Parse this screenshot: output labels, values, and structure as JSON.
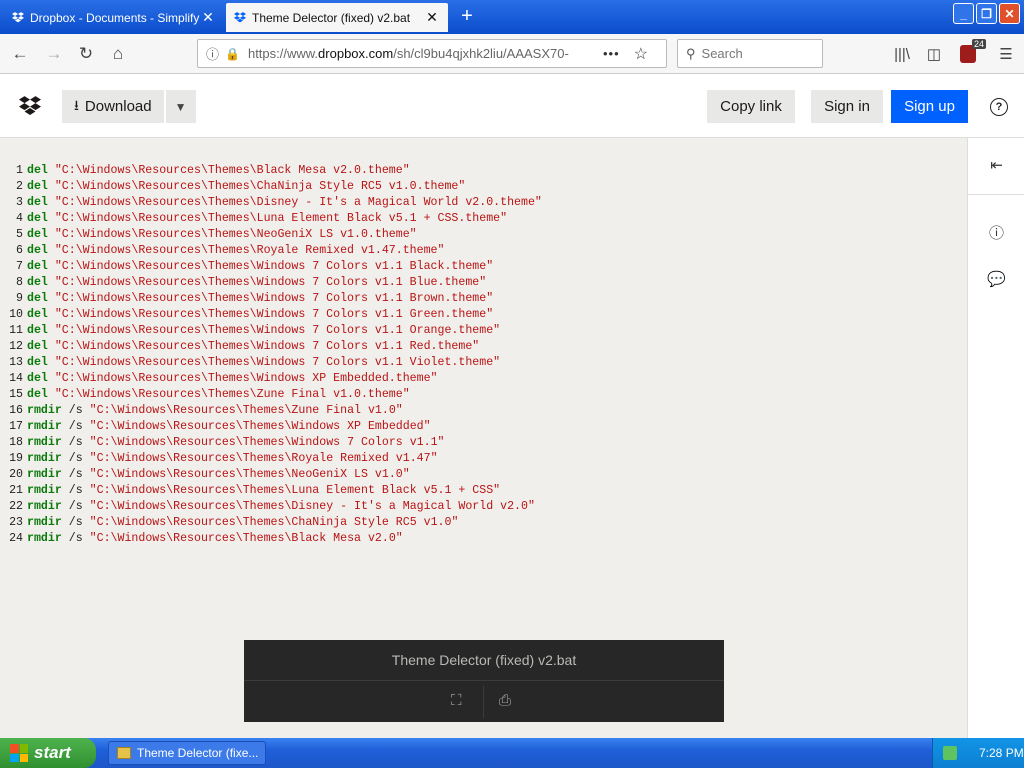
{
  "browser": {
    "tabs": [
      {
        "label": "Dropbox - Documents - Simplify yo",
        "active": false
      },
      {
        "label": "Theme Delector (fixed) v2.bat",
        "active": true
      }
    ],
    "url": {
      "prefix": "https://www.",
      "domain": "dropbox.com",
      "path": "/sh/cl9bu4qjxhk2liu/AAASX70-"
    },
    "search_placeholder": "Search",
    "ublock_count": "24"
  },
  "header": {
    "download_label": "Download",
    "copy_link_label": "Copy link",
    "sign_in_label": "Sign in",
    "sign_up_label": "Sign up",
    "help_label": "?"
  },
  "code_lines": [
    {
      "n": "1",
      "cmd": "del",
      "flag": "",
      "path": "\"C:\\Windows\\Resources\\Themes\\Black Mesa v2.0.theme\""
    },
    {
      "n": "2",
      "cmd": "del",
      "flag": "",
      "path": "\"C:\\Windows\\Resources\\Themes\\ChaNinja Style RC5 v1.0.theme\""
    },
    {
      "n": "3",
      "cmd": "del",
      "flag": "",
      "path": "\"C:\\Windows\\Resources\\Themes\\Disney - It's a Magical World v2.0.theme\""
    },
    {
      "n": "4",
      "cmd": "del",
      "flag": "",
      "path": "\"C:\\Windows\\Resources\\Themes\\Luna Element Black v5.1 + CSS.theme\""
    },
    {
      "n": "5",
      "cmd": "del",
      "flag": "",
      "path": "\"C:\\Windows\\Resources\\Themes\\NeoGeniX LS v1.0.theme\""
    },
    {
      "n": "6",
      "cmd": "del",
      "flag": "",
      "path": "\"C:\\Windows\\Resources\\Themes\\Royale Remixed v1.47.theme\""
    },
    {
      "n": "7",
      "cmd": "del",
      "flag": "",
      "path": "\"C:\\Windows\\Resources\\Themes\\Windows 7 Colors v1.1 Black.theme\""
    },
    {
      "n": "8",
      "cmd": "del",
      "flag": "",
      "path": "\"C:\\Windows\\Resources\\Themes\\Windows 7 Colors v1.1 Blue.theme\""
    },
    {
      "n": "9",
      "cmd": "del",
      "flag": "",
      "path": "\"C:\\Windows\\Resources\\Themes\\Windows 7 Colors v1.1 Brown.theme\""
    },
    {
      "n": "10",
      "cmd": "del",
      "flag": "",
      "path": "\"C:\\Windows\\Resources\\Themes\\Windows 7 Colors v1.1 Green.theme\""
    },
    {
      "n": "11",
      "cmd": "del",
      "flag": "",
      "path": "\"C:\\Windows\\Resources\\Themes\\Windows 7 Colors v1.1 Orange.theme\""
    },
    {
      "n": "12",
      "cmd": "del",
      "flag": "",
      "path": "\"C:\\Windows\\Resources\\Themes\\Windows 7 Colors v1.1 Red.theme\""
    },
    {
      "n": "13",
      "cmd": "del",
      "flag": "",
      "path": "\"C:\\Windows\\Resources\\Themes\\Windows 7 Colors v1.1 Violet.theme\""
    },
    {
      "n": "14",
      "cmd": "del",
      "flag": "",
      "path": "\"C:\\Windows\\Resources\\Themes\\Windows XP Embedded.theme\""
    },
    {
      "n": "15",
      "cmd": "del",
      "flag": "",
      "path": "\"C:\\Windows\\Resources\\Themes\\Zune Final v1.0.theme\""
    },
    {
      "n": "16",
      "cmd": "rmdir",
      "flag": "/s",
      "path": "\"C:\\Windows\\Resources\\Themes\\Zune Final v1.0\""
    },
    {
      "n": "17",
      "cmd": "rmdir",
      "flag": "/s",
      "path": "\"C:\\Windows\\Resources\\Themes\\Windows XP Embedded\""
    },
    {
      "n": "18",
      "cmd": "rmdir",
      "flag": "/s",
      "path": "\"C:\\Windows\\Resources\\Themes\\Windows 7 Colors v1.1\""
    },
    {
      "n": "19",
      "cmd": "rmdir",
      "flag": "/s",
      "path": "\"C:\\Windows\\Resources\\Themes\\Royale Remixed v1.47\""
    },
    {
      "n": "20",
      "cmd": "rmdir",
      "flag": "/s",
      "path": "\"C:\\Windows\\Resources\\Themes\\NeoGeniX LS v1.0\""
    },
    {
      "n": "21",
      "cmd": "rmdir",
      "flag": "/s",
      "path": "\"C:\\Windows\\Resources\\Themes\\Luna Element Black v5.1 + CSS\""
    },
    {
      "n": "22",
      "cmd": "rmdir",
      "flag": "/s",
      "path": "\"C:\\Windows\\Resources\\Themes\\Disney - It's a Magical World v2.0\""
    },
    {
      "n": "23",
      "cmd": "rmdir",
      "flag": "/s",
      "path": "\"C:\\Windows\\Resources\\Themes\\ChaNinja Style RC5 v1.0\""
    },
    {
      "n": "24",
      "cmd": "rmdir",
      "flag": "/s",
      "path": "\"C:\\Windows\\Resources\\Themes\\Black Mesa v2.0\""
    }
  ],
  "preview": {
    "filename": "Theme Delector (fixed) v2.bat"
  },
  "taskbar": {
    "start_label": "start",
    "task_label": "Theme Delector (fixe...",
    "clock": "7:28 PM"
  },
  "colors": {
    "keyword": "#0a7a0a",
    "string": "#b81414",
    "accent": "#0061fe"
  }
}
